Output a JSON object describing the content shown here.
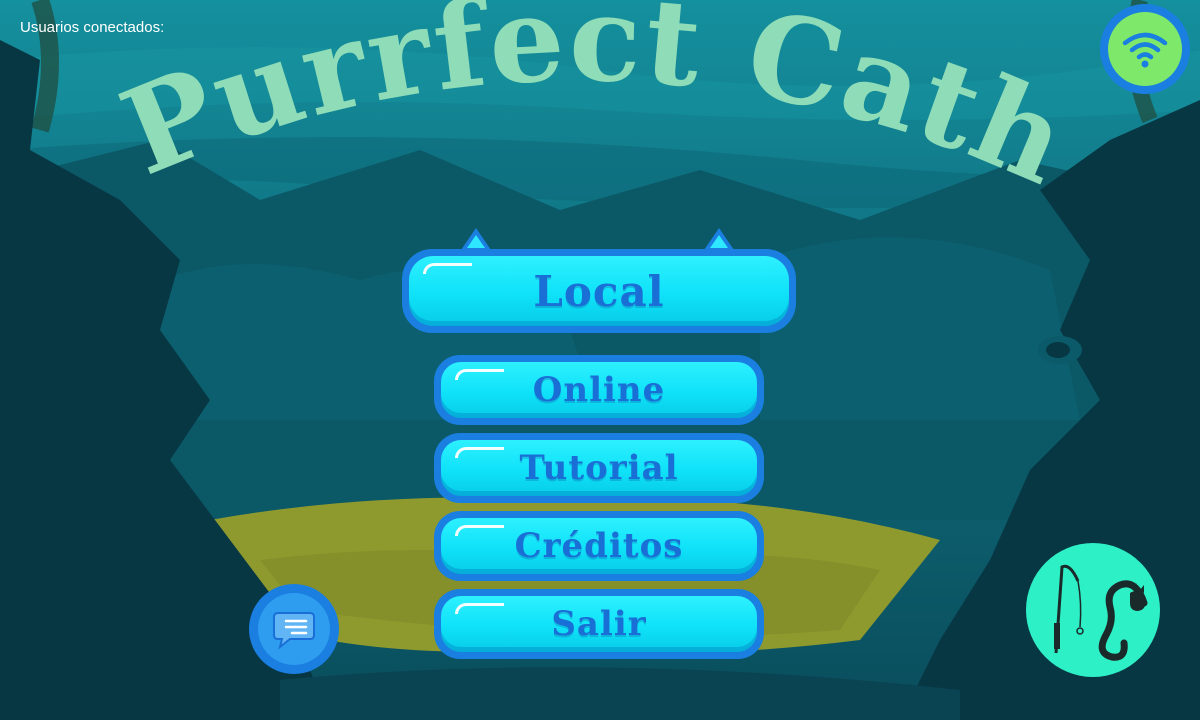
{
  "header": {
    "users_connected_label": "Usuarios conectados:"
  },
  "title": {
    "text": "Purrfect Cath",
    "color": "#8fdcb8"
  },
  "menu": {
    "local_label": "Local",
    "online_label": "Online",
    "tutorial_label": "Tutorial",
    "credits_label": "Créditos",
    "exit_label": "Salir"
  },
  "icons": {
    "wifi": "wifi-icon",
    "chat": "chat-icon",
    "logo": "fishing-rod-cat-logo"
  },
  "colors": {
    "button_fill": "#0fe2f8",
    "button_border": "#1a7fe0",
    "button_text": "#1a6fd6",
    "wifi_bg": "#7ee86a",
    "logo_bg": "#2ef0c6",
    "sand": "#8f9a2e"
  }
}
